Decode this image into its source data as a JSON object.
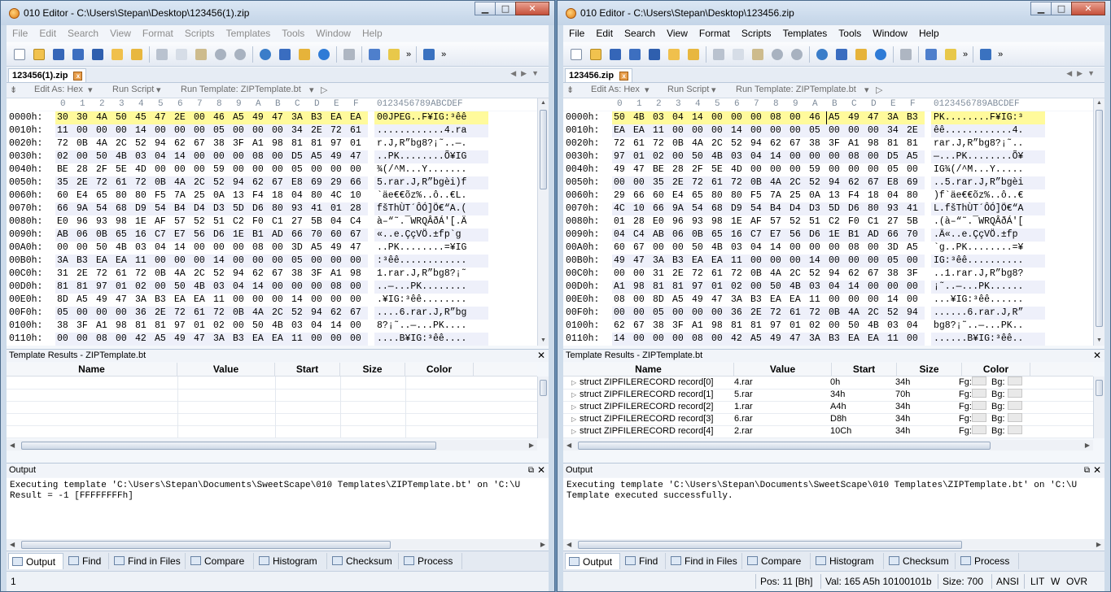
{
  "colors": {
    "accent": "#fffa9c",
    "title_bar": "#c3d4e7",
    "alt_row": "#eef0fa"
  },
  "hex_header": {
    "cols": [
      "0",
      "1",
      "2",
      "3",
      "4",
      "5",
      "6",
      "7",
      "8",
      "9",
      "A",
      "B",
      "C",
      "D",
      "E",
      "F"
    ],
    "ascii": "0123456789ABCDEF"
  },
  "windows": [
    {
      "title": "010 Editor - C:\\Users\\Stepan\\Desktop\\123456(1).zip",
      "menu": [
        "File",
        "Edit",
        "Search",
        "View",
        "Format",
        "Scripts",
        "Templates",
        "Tools",
        "Window",
        "Help"
      ],
      "tab": "123456(1).zip",
      "edit_as": "Edit As: Hex",
      "run_script": "Run Script",
      "run_template": "Run Template: ZIPTemplate.bt",
      "hex_rows": [
        {
          "offset": "0000h:",
          "bytes": [
            "30",
            "30",
            "4A",
            "50",
            "45",
            "47",
            "2E",
            "00",
            "46",
            "A5",
            "49",
            "47",
            "3A",
            "B3",
            "EA",
            "EA"
          ],
          "ascii": "00JPEG..F¥IG:³êê"
        },
        {
          "offset": "0010h:",
          "bytes": [
            "11",
            "00",
            "00",
            "00",
            "14",
            "00",
            "00",
            "00",
            "05",
            "00",
            "00",
            "00",
            "34",
            "2E",
            "72",
            "61"
          ],
          "ascii": "............4.ra"
        },
        {
          "offset": "0020h:",
          "bytes": [
            "72",
            "0B",
            "4A",
            "2C",
            "52",
            "94",
            "62",
            "67",
            "38",
            "3F",
            "A1",
            "98",
            "81",
            "81",
            "97",
            "01"
          ],
          "ascii": "r.J,R”bg8?¡˜..—."
        },
        {
          "offset": "0030h:",
          "bytes": [
            "02",
            "00",
            "50",
            "4B",
            "03",
            "04",
            "14",
            "00",
            "00",
            "00",
            "08",
            "00",
            "D5",
            "A5",
            "49",
            "47"
          ],
          "ascii": "..PK........Õ¥IG"
        },
        {
          "offset": "0040h:",
          "bytes": [
            "BE",
            "28",
            "2F",
            "5E",
            "4D",
            "00",
            "00",
            "00",
            "59",
            "00",
            "00",
            "00",
            "05",
            "00",
            "00",
            "00"
          ],
          "ascii": "¾(/^M...Y......."
        },
        {
          "offset": "0050h:",
          "bytes": [
            "35",
            "2E",
            "72",
            "61",
            "72",
            "0B",
            "4A",
            "2C",
            "52",
            "94",
            "62",
            "67",
            "E8",
            "69",
            "29",
            "66"
          ],
          "ascii": "5.rar.J,R”bgèi)f"
        },
        {
          "offset": "0060h:",
          "bytes": [
            "60",
            "E4",
            "65",
            "80",
            "80",
            "F5",
            "7A",
            "25",
            "0A",
            "13",
            "F4",
            "18",
            "04",
            "80",
            "4C",
            "10"
          ],
          "ascii": "`äe€€õz%..ô..€L."
        },
        {
          "offset": "0070h:",
          "bytes": [
            "66",
            "9A",
            "54",
            "68",
            "D9",
            "54",
            "B4",
            "D4",
            "D3",
            "5D",
            "D6",
            "80",
            "93",
            "41",
            "01",
            "28"
          ],
          "ascii": "fšThÙT´ÔÓ]Ö€“A.("
        },
        {
          "offset": "0080h:",
          "bytes": [
            "E0",
            "96",
            "93",
            "98",
            "1E",
            "AF",
            "57",
            "52",
            "51",
            "C2",
            "F0",
            "C1",
            "27",
            "5B",
            "04",
            "C4"
          ],
          "ascii": "à–“˜.¯WRQÂðÁ'[.Ä"
        },
        {
          "offset": "0090h:",
          "bytes": [
            "AB",
            "06",
            "0B",
            "65",
            "16",
            "C7",
            "E7",
            "56",
            "D6",
            "1E",
            "B1",
            "AD",
            "66",
            "70",
            "60",
            "67"
          ],
          "ascii": "«..e.ÇçVÖ.±­fp`g"
        },
        {
          "offset": "00A0h:",
          "bytes": [
            "00",
            "00",
            "50",
            "4B",
            "03",
            "04",
            "14",
            "00",
            "00",
            "00",
            "08",
            "00",
            "3D",
            "A5",
            "49",
            "47"
          ],
          "ascii": "..PK........=¥IG"
        },
        {
          "offset": "00B0h:",
          "bytes": [
            "3A",
            "B3",
            "EA",
            "EA",
            "11",
            "00",
            "00",
            "00",
            "14",
            "00",
            "00",
            "00",
            "05",
            "00",
            "00",
            "00"
          ],
          "ascii": ":³êê............"
        },
        {
          "offset": "00C0h:",
          "bytes": [
            "31",
            "2E",
            "72",
            "61",
            "72",
            "0B",
            "4A",
            "2C",
            "52",
            "94",
            "62",
            "67",
            "38",
            "3F",
            "A1",
            "98"
          ],
          "ascii": "1.rar.J,R”bg8?¡˜"
        },
        {
          "offset": "00D0h:",
          "bytes": [
            "81",
            "81",
            "97",
            "01",
            "02",
            "00",
            "50",
            "4B",
            "03",
            "04",
            "14",
            "00",
            "00",
            "00",
            "08",
            "00"
          ],
          "ascii": "..—...PK........"
        },
        {
          "offset": "00E0h:",
          "bytes": [
            "8D",
            "A5",
            "49",
            "47",
            "3A",
            "B3",
            "EA",
            "EA",
            "11",
            "00",
            "00",
            "00",
            "14",
            "00",
            "00",
            "00"
          ],
          "ascii": ".¥IG:³êê........"
        },
        {
          "offset": "00F0h:",
          "bytes": [
            "05",
            "00",
            "00",
            "00",
            "36",
            "2E",
            "72",
            "61",
            "72",
            "0B",
            "4A",
            "2C",
            "52",
            "94",
            "62",
            "67"
          ],
          "ascii": "....6.rar.J,R”bg"
        },
        {
          "offset": "0100h:",
          "bytes": [
            "38",
            "3F",
            "A1",
            "98",
            "81",
            "81",
            "97",
            "01",
            "02",
            "00",
            "50",
            "4B",
            "03",
            "04",
            "14",
            "00"
          ],
          "ascii": "8?¡˜..—...PK...."
        },
        {
          "offset": "0110h:",
          "bytes": [
            "00",
            "00",
            "08",
            "00",
            "42",
            "A5",
            "49",
            "47",
            "3A",
            "B3",
            "EA",
            "EA",
            "11",
            "00",
            "00",
            "00"
          ],
          "ascii": "....B¥IG:³êê...."
        }
      ],
      "template_results_title": "Template Results - ZIPTemplate.bt",
      "template_cols": [
        "Name",
        "Value",
        "Start",
        "Size",
        "Color"
      ],
      "template_rows": [],
      "output_title": "Output",
      "output_lines": [
        "Executing template 'C:\\Users\\Stepan\\Documents\\SweetScape\\010 Templates\\ZIPTemplate.bt' on 'C:\\U",
        "Result = -1 [FFFFFFFFh]"
      ],
      "bottom_tabs": [
        "Output",
        "Find",
        "Find in Files",
        "Compare",
        "Histogram",
        "Checksum",
        "Process"
      ],
      "status": {
        "left": "1"
      }
    },
    {
      "title": "010 Editor - C:\\Users\\Stepan\\Desktop\\123456.zip",
      "menu": [
        "File",
        "Edit",
        "Search",
        "View",
        "Format",
        "Scripts",
        "Templates",
        "Tools",
        "Window",
        "Help"
      ],
      "tab": "123456.zip",
      "edit_as": "Edit As: Hex",
      "run_script": "Run Script",
      "run_template": "Run Template: ZIPTemplate.bt",
      "hex_rows": [
        {
          "offset": "0000h:",
          "bytes": [
            "50",
            "4B",
            "03",
            "04",
            "14",
            "00",
            "00",
            "00",
            "08",
            "00",
            "46",
            "A5",
            "49",
            "47",
            "3A",
            "B3"
          ],
          "ascii": "PK........F¥IG:³"
        },
        {
          "offset": "0010h:",
          "bytes": [
            "EA",
            "EA",
            "11",
            "00",
            "00",
            "00",
            "14",
            "00",
            "00",
            "00",
            "05",
            "00",
            "00",
            "00",
            "34",
            "2E"
          ],
          "ascii": "êê............4."
        },
        {
          "offset": "0020h:",
          "bytes": [
            "72",
            "61",
            "72",
            "0B",
            "4A",
            "2C",
            "52",
            "94",
            "62",
            "67",
            "38",
            "3F",
            "A1",
            "98",
            "81",
            "81"
          ],
          "ascii": "rar.J,R”bg8?¡˜.."
        },
        {
          "offset": "0030h:",
          "bytes": [
            "97",
            "01",
            "02",
            "00",
            "50",
            "4B",
            "03",
            "04",
            "14",
            "00",
            "00",
            "00",
            "08",
            "00",
            "D5",
            "A5"
          ],
          "ascii": "—...PK........Õ¥"
        },
        {
          "offset": "0040h:",
          "bytes": [
            "49",
            "47",
            "BE",
            "28",
            "2F",
            "5E",
            "4D",
            "00",
            "00",
            "00",
            "59",
            "00",
            "00",
            "00",
            "05",
            "00"
          ],
          "ascii": "IG¾(/^M...Y....."
        },
        {
          "offset": "0050h:",
          "bytes": [
            "00",
            "00",
            "35",
            "2E",
            "72",
            "61",
            "72",
            "0B",
            "4A",
            "2C",
            "52",
            "94",
            "62",
            "67",
            "E8",
            "69"
          ],
          "ascii": "..5.rar.J,R”bgèi"
        },
        {
          "offset": "0060h:",
          "bytes": [
            "29",
            "66",
            "60",
            "E4",
            "65",
            "80",
            "80",
            "F5",
            "7A",
            "25",
            "0A",
            "13",
            "F4",
            "18",
            "04",
            "80"
          ],
          "ascii": ")f`äe€€õz%..ô..€"
        },
        {
          "offset": "0070h:",
          "bytes": [
            "4C",
            "10",
            "66",
            "9A",
            "54",
            "68",
            "D9",
            "54",
            "B4",
            "D4",
            "D3",
            "5D",
            "D6",
            "80",
            "93",
            "41"
          ],
          "ascii": "L.fšThÙT´ÔÓ]Ö€“A"
        },
        {
          "offset": "0080h:",
          "bytes": [
            "01",
            "28",
            "E0",
            "96",
            "93",
            "98",
            "1E",
            "AF",
            "57",
            "52",
            "51",
            "C2",
            "F0",
            "C1",
            "27",
            "5B"
          ],
          "ascii": ".(à–“˜.¯WRQÂðÁ'["
        },
        {
          "offset": "0090h:",
          "bytes": [
            "04",
            "C4",
            "AB",
            "06",
            "0B",
            "65",
            "16",
            "C7",
            "E7",
            "56",
            "D6",
            "1E",
            "B1",
            "AD",
            "66",
            "70"
          ],
          "ascii": ".Ä«..e.ÇçVÖ.±­fp"
        },
        {
          "offset": "00A0h:",
          "bytes": [
            "60",
            "67",
            "00",
            "00",
            "50",
            "4B",
            "03",
            "04",
            "14",
            "00",
            "00",
            "00",
            "08",
            "00",
            "3D",
            "A5"
          ],
          "ascii": "`g..PK........=¥"
        },
        {
          "offset": "00B0h:",
          "bytes": [
            "49",
            "47",
            "3A",
            "B3",
            "EA",
            "EA",
            "11",
            "00",
            "00",
            "00",
            "14",
            "00",
            "00",
            "00",
            "05",
            "00"
          ],
          "ascii": "IG:³êê.........."
        },
        {
          "offset": "00C0h:",
          "bytes": [
            "00",
            "00",
            "31",
            "2E",
            "72",
            "61",
            "72",
            "0B",
            "4A",
            "2C",
            "52",
            "94",
            "62",
            "67",
            "38",
            "3F"
          ],
          "ascii": "..1.rar.J,R”bg8?"
        },
        {
          "offset": "00D0h:",
          "bytes": [
            "A1",
            "98",
            "81",
            "81",
            "97",
            "01",
            "02",
            "00",
            "50",
            "4B",
            "03",
            "04",
            "14",
            "00",
            "00",
            "00"
          ],
          "ascii": "¡˜..—...PK......"
        },
        {
          "offset": "00E0h:",
          "bytes": [
            "08",
            "00",
            "8D",
            "A5",
            "49",
            "47",
            "3A",
            "B3",
            "EA",
            "EA",
            "11",
            "00",
            "00",
            "00",
            "14",
            "00"
          ],
          "ascii": "...¥IG:³êê......"
        },
        {
          "offset": "00F0h:",
          "bytes": [
            "00",
            "00",
            "05",
            "00",
            "00",
            "00",
            "36",
            "2E",
            "72",
            "61",
            "72",
            "0B",
            "4A",
            "2C",
            "52",
            "94"
          ],
          "ascii": "......6.rar.J,R”"
        },
        {
          "offset": "0100h:",
          "bytes": [
            "62",
            "67",
            "38",
            "3F",
            "A1",
            "98",
            "81",
            "81",
            "97",
            "01",
            "02",
            "00",
            "50",
            "4B",
            "03",
            "04"
          ],
          "ascii": "bg8?¡˜..—...PK.."
        },
        {
          "offset": "0110h:",
          "bytes": [
            "14",
            "00",
            "00",
            "00",
            "08",
            "00",
            "42",
            "A5",
            "49",
            "47",
            "3A",
            "B3",
            "EA",
            "EA",
            "11",
            "00"
          ],
          "ascii": "......B¥IG:³êê.."
        }
      ],
      "template_results_title": "Template Results - ZIPTemplate.bt",
      "template_cols": [
        "Name",
        "Value",
        "Start",
        "Size",
        "Color"
      ],
      "template_rows": [
        {
          "name": "struct ZIPFILERECORD record[0]",
          "value": "4.rar",
          "start": "0h",
          "size": "34h",
          "fg": "Fg:",
          "bg": "Bg:"
        },
        {
          "name": "struct ZIPFILERECORD record[1]",
          "value": "5.rar",
          "start": "34h",
          "size": "70h",
          "fg": "Fg:",
          "bg": "Bg:"
        },
        {
          "name": "struct ZIPFILERECORD record[2]",
          "value": "1.rar",
          "start": "A4h",
          "size": "34h",
          "fg": "Fg:",
          "bg": "Bg:"
        },
        {
          "name": "struct ZIPFILERECORD record[3]",
          "value": "6.rar",
          "start": "D8h",
          "size": "34h",
          "fg": "Fg:",
          "bg": "Bg:"
        },
        {
          "name": "struct ZIPFILERECORD record[4]",
          "value": "2.rar",
          "start": "10Ch",
          "size": "34h",
          "fg": "Fg:",
          "bg": "Bg:"
        }
      ],
      "output_title": "Output",
      "output_lines": [
        "Executing template 'C:\\Users\\Stepan\\Documents\\SweetScape\\010 Templates\\ZIPTemplate.bt' on 'C:\\U",
        "Template executed successfully."
      ],
      "bottom_tabs": [
        "Output",
        "Find",
        "Find in Files",
        "Compare",
        "Histogram",
        "Checksum",
        "Process"
      ],
      "status": {
        "pos": "Pos: 11 [Bh]",
        "val": "Val: 165 A5h 10100101b",
        "size": "Size: 700",
        "enc": "ANSI",
        "lit": "LIT",
        "w": "W",
        "ovr": "OVR"
      }
    }
  ]
}
